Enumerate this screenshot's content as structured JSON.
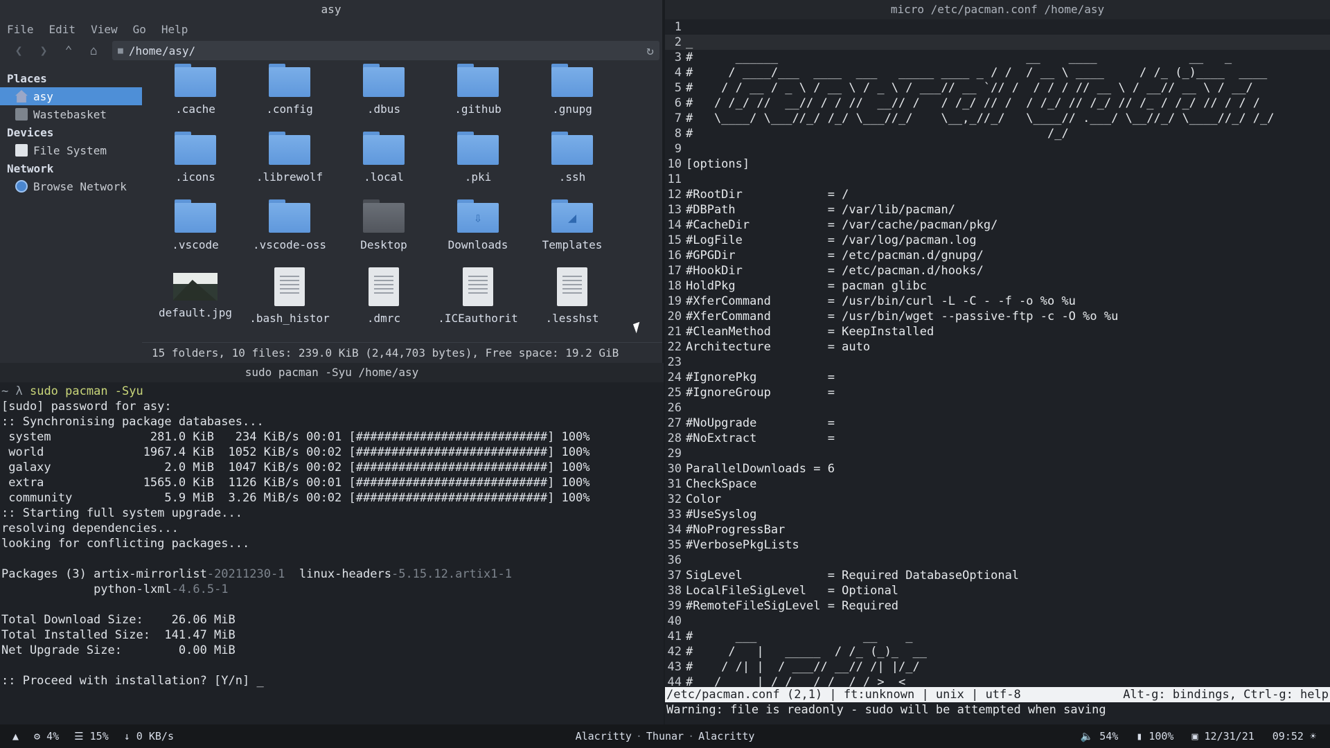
{
  "file_manager": {
    "title": "asy",
    "menu": [
      "File",
      "Edit",
      "View",
      "Go",
      "Help"
    ],
    "path": "/home/asy/",
    "sidebar": {
      "places_heading": "Places",
      "places": [
        "asy",
        "Wastebasket"
      ],
      "devices_heading": "Devices",
      "devices": [
        "File System"
      ],
      "network_heading": "Network",
      "network": [
        "Browse Network"
      ]
    },
    "files": [
      ".cache",
      ".config",
      ".dbus",
      ".github",
      ".gnupg",
      ".icons",
      ".librewolf",
      ".local",
      ".pki",
      ".ssh",
      ".vscode",
      ".vscode-oss",
      "Desktop",
      "Downloads",
      "Templates",
      "default.jpg",
      ".bash_histor",
      ".dmrc",
      ".ICEauthorit",
      ".lesshst"
    ],
    "status": "15 folders, 10 files: 239.0 KiB (2,44,703 bytes), Free space: 19.2 GiB"
  },
  "terminal": {
    "title": "sudo pacman -Syu /home/asy",
    "prompt": "~ λ",
    "command": "sudo pacman -Syu",
    "lines": [
      "[sudo] password for asy:",
      ":: Synchronising package databases...",
      " system              281.0 KiB   234 KiB/s 00:01 [###########################] 100%",
      " world              1967.4 KiB  1052 KiB/s 00:02 [###########################] 100%",
      " galaxy                2.0 MiB  1047 KiB/s 00:02 [###########################] 100%",
      " extra              1565.0 KiB  1126 KiB/s 00:01 [###########################] 100%",
      " community             5.9 MiB  3.26 MiB/s 00:02 [###########################] 100%",
      ":: Starting full system upgrade...",
      "resolving dependencies...",
      "looking for conflicting packages...",
      ""
    ],
    "packages_label": "Packages (3) ",
    "pkg1_name": "artix-mirrorlist",
    "pkg1_ver": "-20211230-1",
    "pkg2_name": "linux-headers",
    "pkg2_ver": "-5.15.12.artix1-1",
    "pkg3_name": "python-lxml",
    "pkg3_ver": "-4.6.5-1",
    "summary": [
      "",
      "Total Download Size:    26.06 MiB",
      "Total Installed Size:  141.47 MiB",
      "Net Upgrade Size:        0.00 MiB",
      "",
      ":: Proceed with installation? [Y/n] _"
    ]
  },
  "editor": {
    "title": "micro /etc/pacman.conf /home/asy",
    "lines": [
      "",
      "_",
      "#      ______                                   __    ____             __   _ ",
      "#     / ____/___  ____  ___   _____ ____ _ / /  / __ \\ ____     / /_ (_)____  ____ ",
      "#    / / __ / _ \\ / __ \\ / _ \\ / ___// __ `// /  / / / // __ \\ / __// __ \\ / __/",
      "#   / /_/ //  __// / / //  __// /   / /_/ // /  / /_/ // /_/ // /_ / /_/ // / / /",
      "#   \\____/ \\___//_/ /_/ \\___//_/    \\__,_//_/   \\____// .___/ \\__//_/ \\____//_/ /_/",
      "#                                                  /_/",
      "",
      "[options]",
      "",
      "#RootDir            = /",
      "#DBPath             = /var/lib/pacman/",
      "#CacheDir           = /var/cache/pacman/pkg/",
      "#LogFile            = /var/log/pacman.log",
      "#GPGDir             = /etc/pacman.d/gnupg/",
      "#HookDir            = /etc/pacman.d/hooks/",
      "HoldPkg             = pacman glibc",
      "#XferCommand        = /usr/bin/curl -L -C - -f -o %o %u",
      "#XferCommand        = /usr/bin/wget --passive-ftp -c -O %o %u",
      "#CleanMethod        = KeepInstalled",
      "Architecture        = auto",
      "",
      "#IgnorePkg          =",
      "#IgnoreGroup        =",
      "",
      "#NoUpgrade          =",
      "#NoExtract          =",
      "",
      "ParallelDownloads = 6",
      "CheckSpace",
      "Color",
      "#UseSyslog",
      "#NoProgressBar",
      "#VerbosePkgLists",
      "",
      "SigLevel            = Required DatabaseOptional",
      "LocalFileSigLevel   = Optional",
      "#RemoteFileSigLevel = Required",
      "",
      "#      ___               __    _ ",
      "#     /   |   _____  / /_ (_)_  __",
      "#    / /| |  / ___// __// /| |/_/",
      "#   / ___ | / /   / /_ / /_>  <"
    ],
    "status_left": "/etc/pacman.conf (2,1) | ft:unknown | unix | utf-8",
    "status_right": "Alt-g: bindings, Ctrl-g: help",
    "message": "Warning: file is readonly - sudo will be attempted when saving"
  },
  "panel": {
    "cpu": "4%",
    "mem": "15%",
    "net": "0 KB/s",
    "windows": [
      "Alacritty",
      "Thunar",
      "Alacritty"
    ],
    "volume": "54%",
    "battery": "100%",
    "date": "12/31/21",
    "time": "09:52"
  }
}
